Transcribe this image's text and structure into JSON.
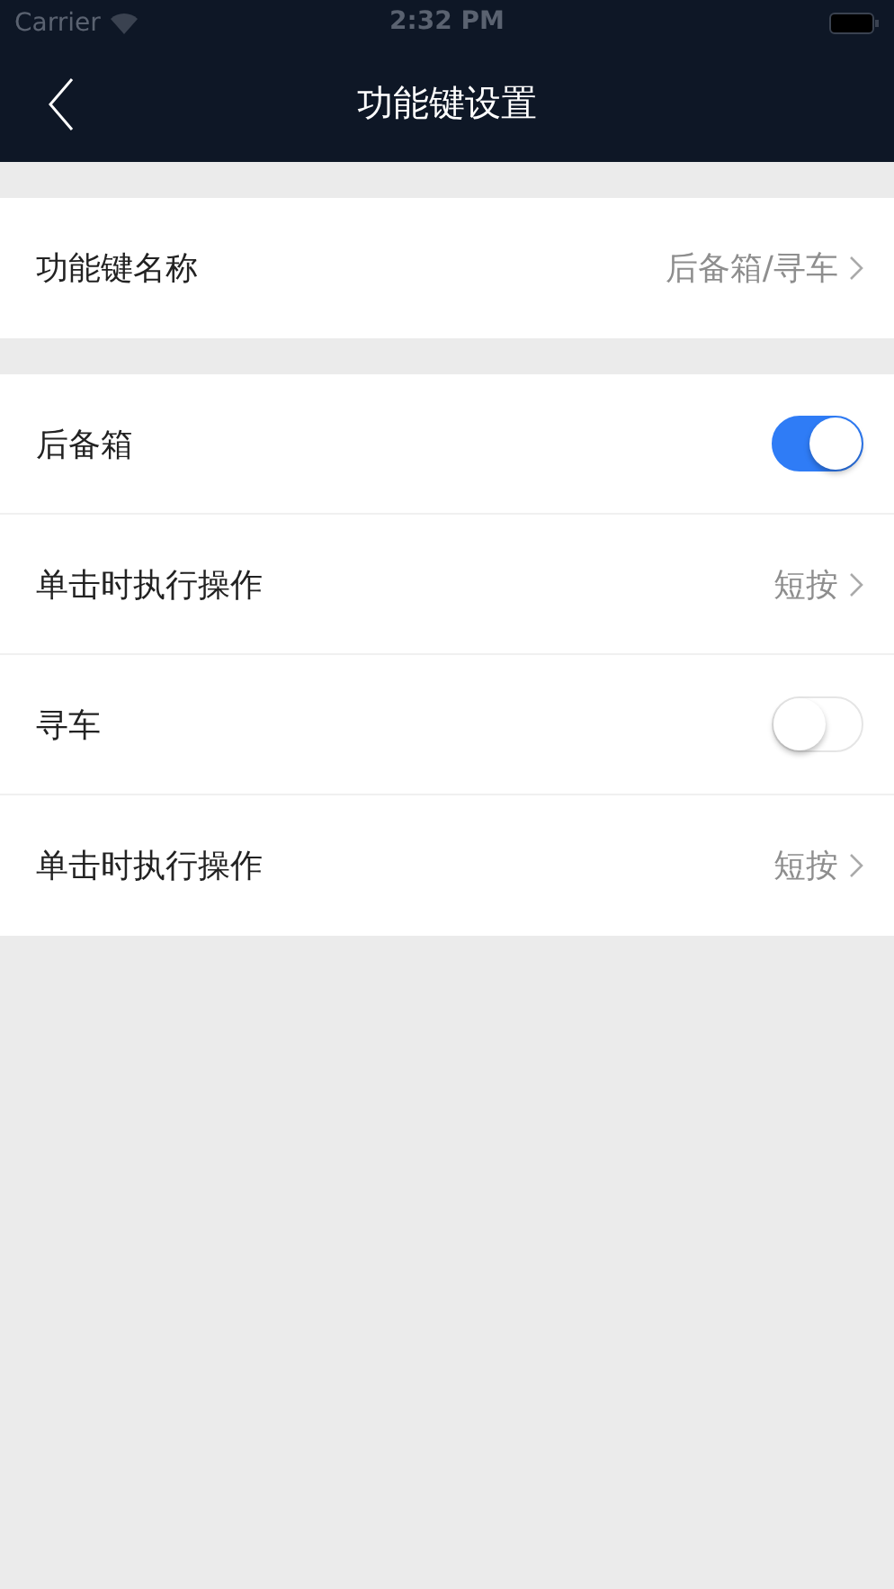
{
  "status_bar": {
    "carrier": "Carrier",
    "time": "2:32 PM"
  },
  "nav_bar": {
    "title": "功能键设置"
  },
  "groups": [
    {
      "rows": [
        {
          "kind": "link",
          "label": "功能键名称",
          "value": "后备箱/寻车"
        }
      ]
    },
    {
      "rows": [
        {
          "kind": "switch",
          "label": "后备箱",
          "on": true
        },
        {
          "kind": "link",
          "label": "单击时执行操作",
          "value": "短按"
        },
        {
          "kind": "switch",
          "label": "寻车",
          "on": false
        },
        {
          "kind": "link",
          "label": "单击时执行操作",
          "value": "短按"
        }
      ]
    }
  ]
}
